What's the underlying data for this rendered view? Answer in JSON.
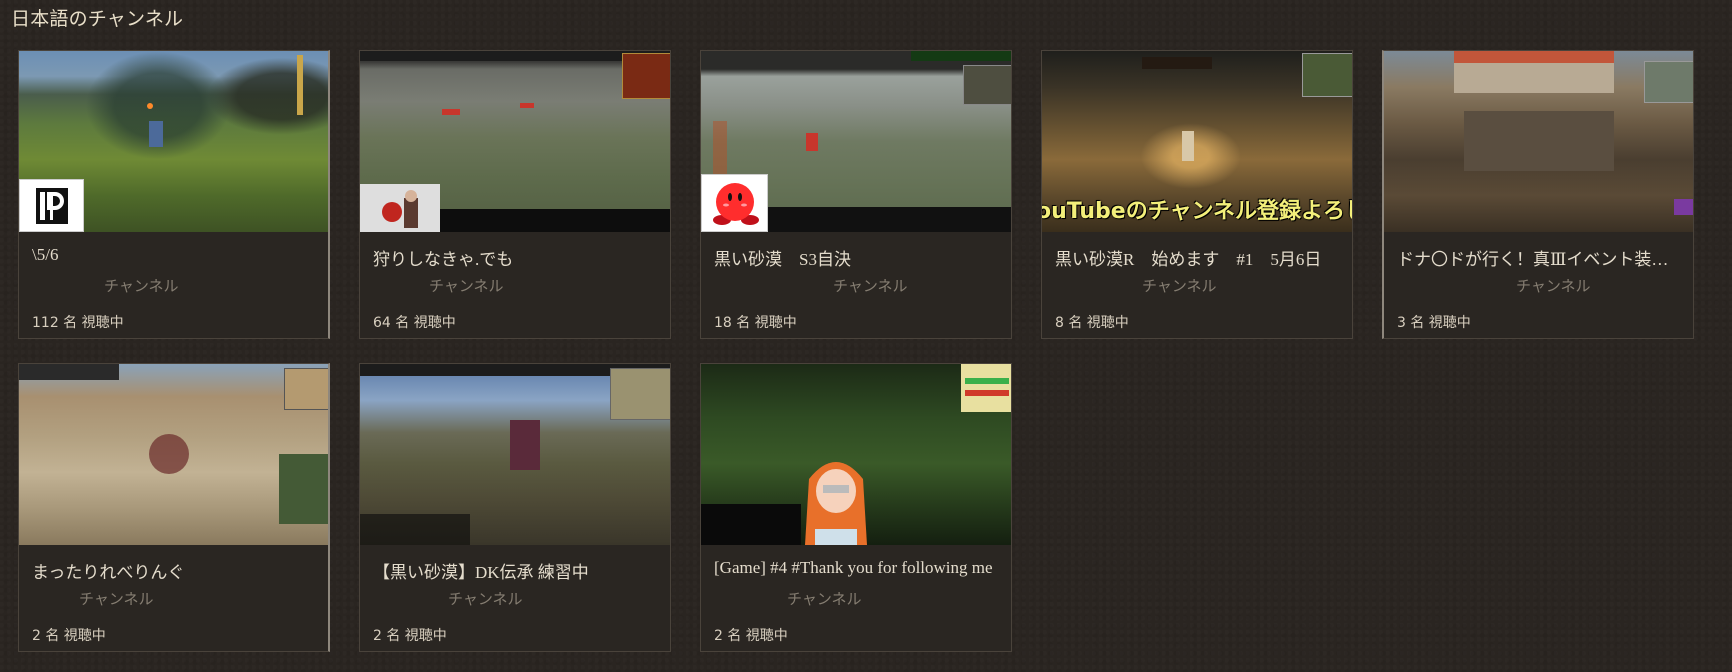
{
  "section": {
    "title": "日本語のチャンネル"
  },
  "cards": [
    {
      "title": "\\5/6",
      "channel": "チャンネル",
      "viewers": "112 名 視聴中",
      "banner": "",
      "logo": "P"
    },
    {
      "title": "狩りしなきゃ.でも",
      "channel": "チャンネル",
      "viewers": "64 名 視聴中",
      "banner": "",
      "logo": ""
    },
    {
      "title": "黒い砂漠　S3自決",
      "channel": "チャンネル",
      "viewers": "18 名 視聴中",
      "banner": "",
      "logo": ""
    },
    {
      "title": "黒い砂漠R　始めます　#1　5月6日",
      "channel": "チャンネル",
      "viewers": "8 名 視聴中",
      "banner": "ouTubeのチャンネル登録よろし",
      "logo": ""
    },
    {
      "title": "ドナ〇ドが行く！真Ⅲイベント装備をエヴォ",
      "channel": "チャンネル",
      "viewers": "3 名 視聴中",
      "banner": "",
      "logo": ""
    },
    {
      "title": "まったりれべりんぐ",
      "channel": "チャンネル",
      "viewers": "2 名 視聴中",
      "banner": "",
      "logo": ""
    },
    {
      "title": "【黒い砂漠】DK伝承 練習中",
      "channel": "チャンネル",
      "viewers": "2 名 視聴中",
      "banner": "",
      "logo": ""
    },
    {
      "title": "[Game] #4 #Thank you for following me",
      "channel": "チャンネル",
      "viewers": "2 名 視聴中",
      "banner": "",
      "logo": ""
    }
  ]
}
